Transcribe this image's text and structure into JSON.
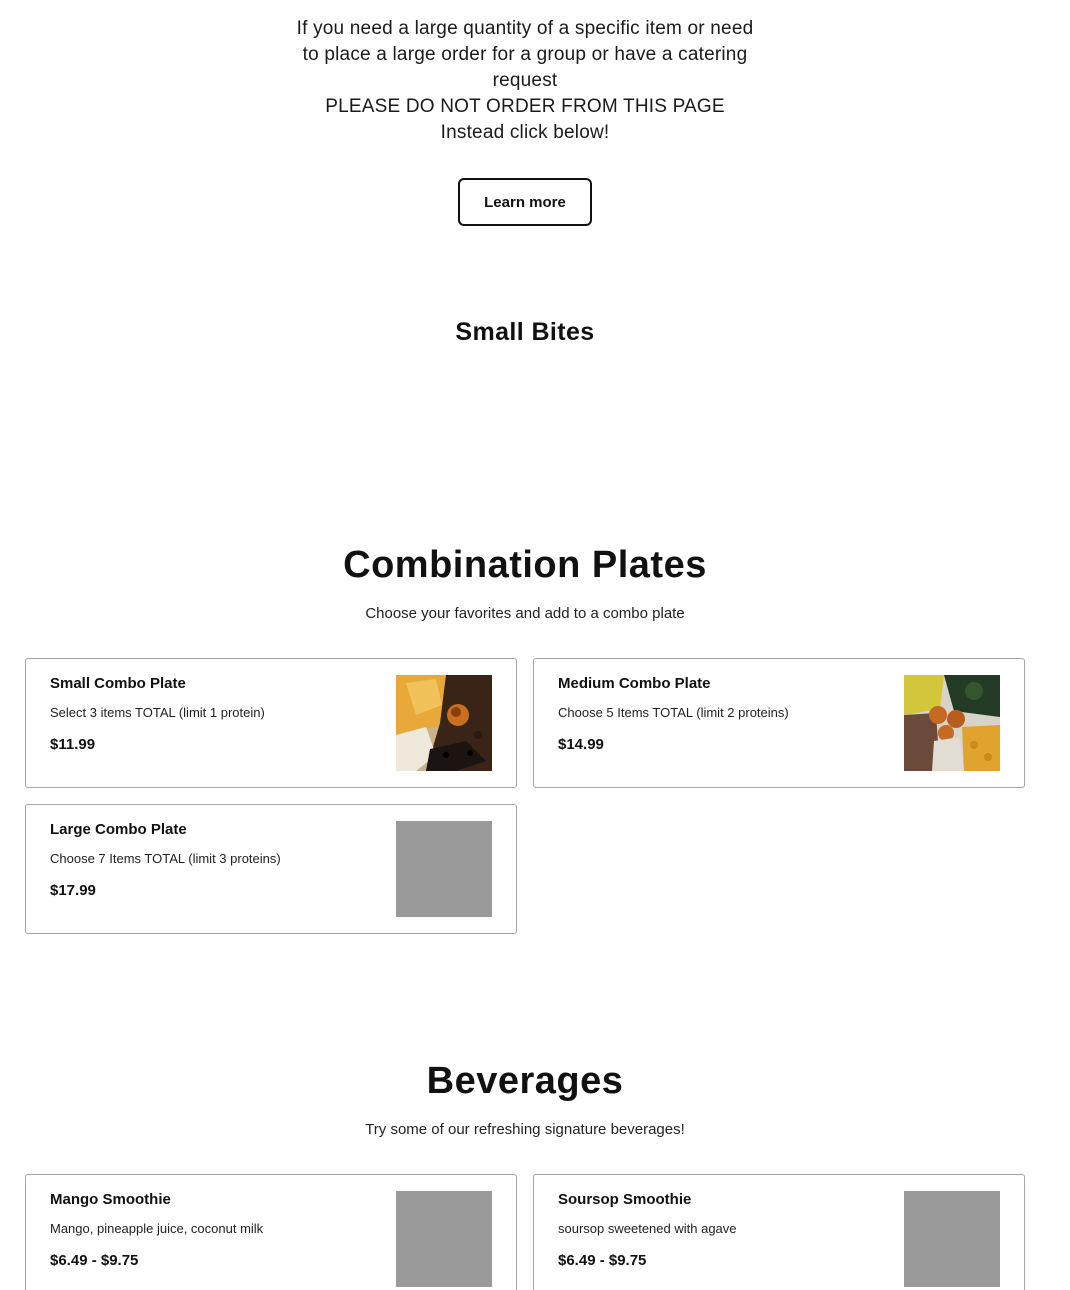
{
  "notice": {
    "line1": "If you need a large quantity of a specific item or need",
    "line2": "to place a large order for a group or have a catering",
    "line3": "request",
    "line4": "PLEASE DO NOT ORDER FROM THIS PAGE",
    "line5": "Instead click below!",
    "button_label": "Learn more"
  },
  "small_bites": {
    "title": "Small Bites"
  },
  "combination_plates": {
    "title": "Combination Plates",
    "subtitle": "Choose your favorites and add to a combo plate",
    "items": [
      {
        "name": "Small Combo Plate",
        "description": "Select 3 items TOTAL (limit 1 protein)",
        "price": "$11.99",
        "image": "food-photo"
      },
      {
        "name": "Medium Combo Plate",
        "description": "Choose 5 Items TOTAL (limit 2 proteins)",
        "price": "$14.99",
        "image": "food-photo"
      },
      {
        "name": "Large Combo Plate",
        "description": "Choose 7 Items TOTAL (limit 3 proteins)",
        "price": "$17.99",
        "image": "placeholder"
      }
    ]
  },
  "beverages": {
    "title": "Beverages",
    "subtitle": "Try some of our refreshing signature beverages!",
    "items": [
      {
        "name": "Mango Smoothie",
        "description": "Mango, pineapple juice, coconut milk",
        "price": "$6.49 - $9.75",
        "image": "placeholder"
      },
      {
        "name": "Soursop Smoothie",
        "description": "soursop sweetened with agave",
        "price": "$6.49 - $9.75",
        "image": "placeholder"
      }
    ]
  },
  "colors": {
    "text": "#111111",
    "card_border": "#a6a6a6",
    "placeholder": "#9a9a9a"
  }
}
